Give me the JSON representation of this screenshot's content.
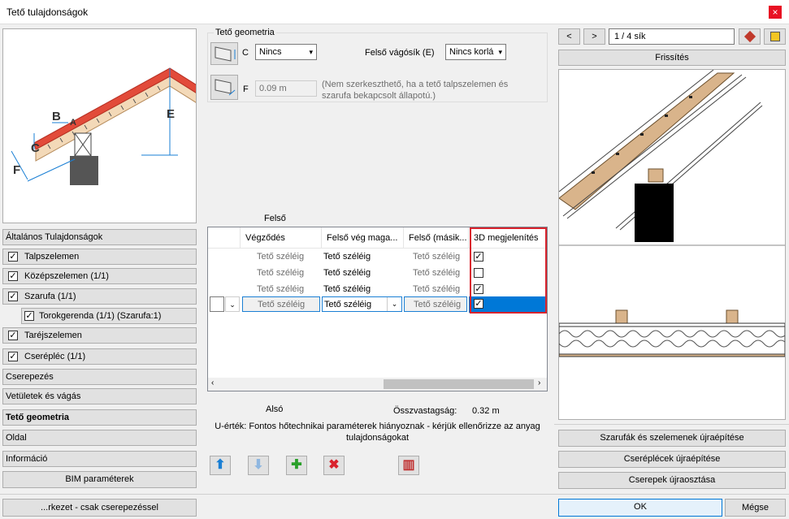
{
  "window": {
    "title": "Tető tulajdonságok",
    "close": "×"
  },
  "left": {
    "diagram_labels": {
      "b": "B",
      "a": "A",
      "c": "C",
      "e": "E",
      "f": "F"
    },
    "sections": [
      {
        "label": "Általános Tulajdonságok"
      },
      {
        "label": "Talpszelemen",
        "checked": true
      },
      {
        "label": "Középszelemen (1/1)",
        "checked": true
      },
      {
        "label": "Szarufa (1/1)",
        "checked": true
      },
      {
        "label": "Torokgerenda (1/1) (Szarufa:1)",
        "checked": true
      },
      {
        "label": "Taréjszelemen",
        "checked": true
      },
      {
        "label": "Cserépléc (1/1)",
        "checked": true
      },
      {
        "label": "Cserepezés"
      },
      {
        "label": "Vetületek és vágás"
      },
      {
        "label": "Tető geometria",
        "active": true
      },
      {
        "label": "Oldal"
      },
      {
        "label": "Információ"
      }
    ],
    "bim_button": "BIM paraméterek",
    "bottom_button": "...rkezet - csak cserepezéssel"
  },
  "geometry": {
    "group_title": "Tető geometria",
    "c_label": "C",
    "c_value": "Nincs",
    "upper_cut_label": "Felső vágósík (E)",
    "upper_cut_value": "Nincs korlá",
    "f_label": "F",
    "f_value": "0.09 m",
    "f_note_line1": "(Nem szerkeszthető, ha a tető talpszelemen és",
    "f_note_line2": "szarufa bekapcsolt állapotú.)"
  },
  "grid": {
    "group_label": "Felső",
    "headers": [
      "Végződés",
      "Felső vég maga...",
      "Felső (másik...",
      "3D megjelenítés"
    ],
    "rows": [
      {
        "c1": "Tető széléig",
        "c2": "Tető széléig",
        "c3": "Tető széléig",
        "checked": true
      },
      {
        "c1": "Tető széléig",
        "c2": "Tető széléig",
        "c3": "Tető széléig",
        "checked": false
      },
      {
        "c1": "Tető széléig",
        "c2": "Tető széléig",
        "c3": "Tető széléig",
        "checked": true
      },
      {
        "c1": "Tető széléig",
        "c2": "Tető széléig",
        "c3": "Tető széléig",
        "checked": true
      }
    ]
  },
  "info": {
    "lower_label": "Alsó",
    "thickness_label": "Összvastagság:",
    "thickness_value": "0.32 m",
    "uvalue_line1": "U-érték: Fontos hőtechnikai paraméterek hiányoznak - kérjük ellenőrizze az anyag",
    "uvalue_line2": "tulajdonságokat"
  },
  "right": {
    "prev": "<",
    "next": ">",
    "plane_counter": "1 / 4 sík",
    "refresh": "Frissítés",
    "rebuild_rafters": "Szarufák és szelemenek újraépítése",
    "rebuild_battens": "Cseréplécek újraépítése",
    "redistribute_tiles": "Cserepek újraosztása"
  },
  "footer": {
    "ok": "OK",
    "cancel": "Mégse"
  }
}
